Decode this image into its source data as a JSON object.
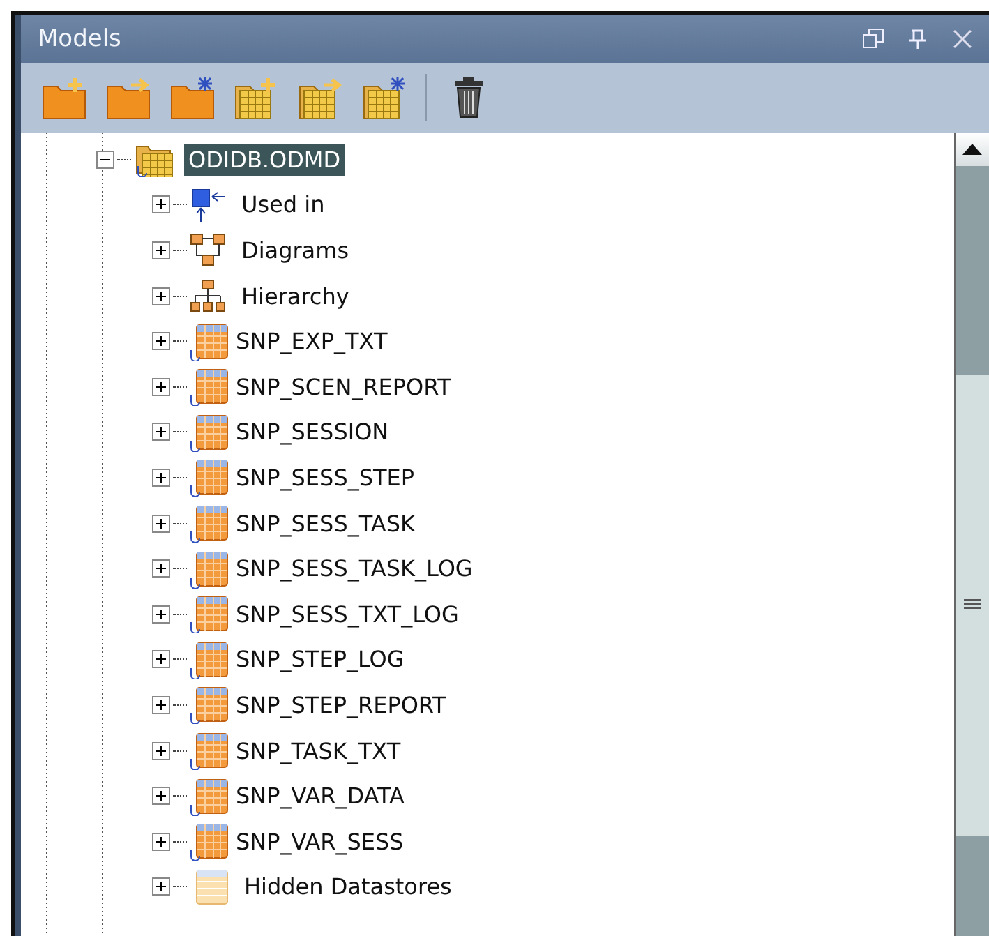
{
  "window": {
    "title": "Models"
  },
  "tree": [
    {
      "label": "ODIDB.ODMD",
      "kind": "model",
      "expanded": true,
      "selected": true,
      "children": [
        {
          "label": "Used in",
          "kind": "usage",
          "expanded": false,
          "selected": false
        },
        {
          "label": "Diagrams",
          "kind": "diagram",
          "expanded": false,
          "selected": false
        },
        {
          "label": "Hierarchy",
          "kind": "hierarchy",
          "expanded": false,
          "selected": false
        },
        {
          "label": "SNP_EXP_TXT",
          "kind": "datastore",
          "expanded": false,
          "selected": false
        },
        {
          "label": "SNP_SCEN_REPORT",
          "kind": "datastore",
          "expanded": false,
          "selected": false
        },
        {
          "label": "SNP_SESSION",
          "kind": "datastore",
          "expanded": false,
          "selected": false
        },
        {
          "label": "SNP_SESS_STEP",
          "kind": "datastore",
          "expanded": false,
          "selected": false
        },
        {
          "label": "SNP_SESS_TASK",
          "kind": "datastore",
          "expanded": false,
          "selected": false
        },
        {
          "label": "SNP_SESS_TASK_LOG",
          "kind": "datastore",
          "expanded": false,
          "selected": false
        },
        {
          "label": "SNP_SESS_TXT_LOG",
          "kind": "datastore",
          "expanded": false,
          "selected": false
        },
        {
          "label": "SNP_STEP_LOG",
          "kind": "datastore",
          "expanded": false,
          "selected": false
        },
        {
          "label": "SNP_STEP_REPORT",
          "kind": "datastore",
          "expanded": false,
          "selected": false
        },
        {
          "label": "SNP_TASK_TXT",
          "kind": "datastore",
          "expanded": false,
          "selected": false
        },
        {
          "label": "SNP_VAR_DATA",
          "kind": "datastore",
          "expanded": false,
          "selected": false
        },
        {
          "label": "SNP_VAR_SESS",
          "kind": "datastore",
          "expanded": false,
          "selected": false
        },
        {
          "label": "Hidden Datastores",
          "kind": "hidden",
          "expanded": false,
          "selected": false
        }
      ]
    }
  ]
}
